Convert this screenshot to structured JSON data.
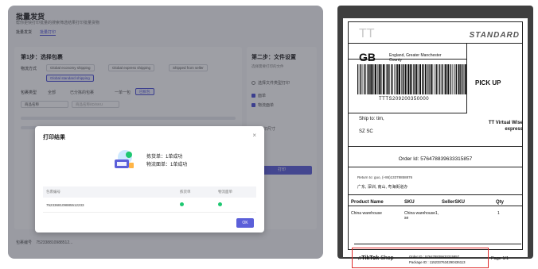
{
  "left": {
    "title": "批量发货",
    "subtitle": "帮你更快打印批量的搜索筛选结果打印批量货物",
    "tabs": [
      "批量发货",
      "批量打印"
    ],
    "step1": {
      "title": "第1步：选择包裹",
      "shipping_label": "物流方式",
      "shipping_options": [
        "Global economy shipping",
        "Global express shipping",
        "Shipped from seller",
        "Global standard shipping"
      ],
      "package_label": "包裹类型",
      "package_options": [
        "全部",
        "已分拣的包裹",
        "一单一包",
        "已拆包"
      ],
      "filter_placeholder": "商品名称",
      "search_placeholder": "商品名称/ID/SKU"
    },
    "step2": {
      "title": "第二步：文件设置",
      "desc": "选择需要打印的文件",
      "opt_all": "选择文件类型打印",
      "opt_label": "面单",
      "opt_list": "物流面单",
      "size_label": "面单打印尺寸",
      "size_opt1": "A6",
      "size_opt2": "A4",
      "print_button": "打印"
    },
    "bottom": {
      "left": "包裹编号",
      "id": "752338810988512..."
    }
  },
  "modal": {
    "title": "打印结果",
    "close": "×",
    "result_line1": "拣货单：1单成功",
    "result_line2": "物流面单：1单成功",
    "columns": [
      "包裹编号",
      "拣货单",
      "物流面单"
    ],
    "rows": [
      {
        "id": "7523368109885512233"
      }
    ],
    "ok_button": "OK"
  },
  "label": {
    "carrier_mark": "TT",
    "service": "STANDARD",
    "country": "GB",
    "region": "England, Greater Manchester County",
    "pickup": "PICK UP",
    "tracking": "TTTS209200350000",
    "ship_to": "Ship to: tim,",
    "ship_city": "SZ SC",
    "tt_virtual": "TT Virtual Wise express",
    "order_id_line": "Order Id: 576478839633315857",
    "return_to": "Return to: guo, (+86)13378858876",
    "return_addr": "广东, 深圳, 南山, 粤海街道办",
    "headers": [
      "Product Name",
      "SKU",
      "SellerSKU",
      "Qty"
    ],
    "item": {
      "name": "China warehouse",
      "sku": "China warehouse1, se",
      "seller_sku": "",
      "qty": "1"
    },
    "footer_brand": "TikTok",
    "footer_shop": "Shop",
    "footer_order": "Order ID : 576478839633315857",
    "footer_package": "Package ID : 1152337634290436113",
    "page": "Page 1/1"
  },
  "colors": {
    "accent": "#5b5fd9",
    "success": "#1ec771",
    "highlight": "#e02b2b"
  }
}
